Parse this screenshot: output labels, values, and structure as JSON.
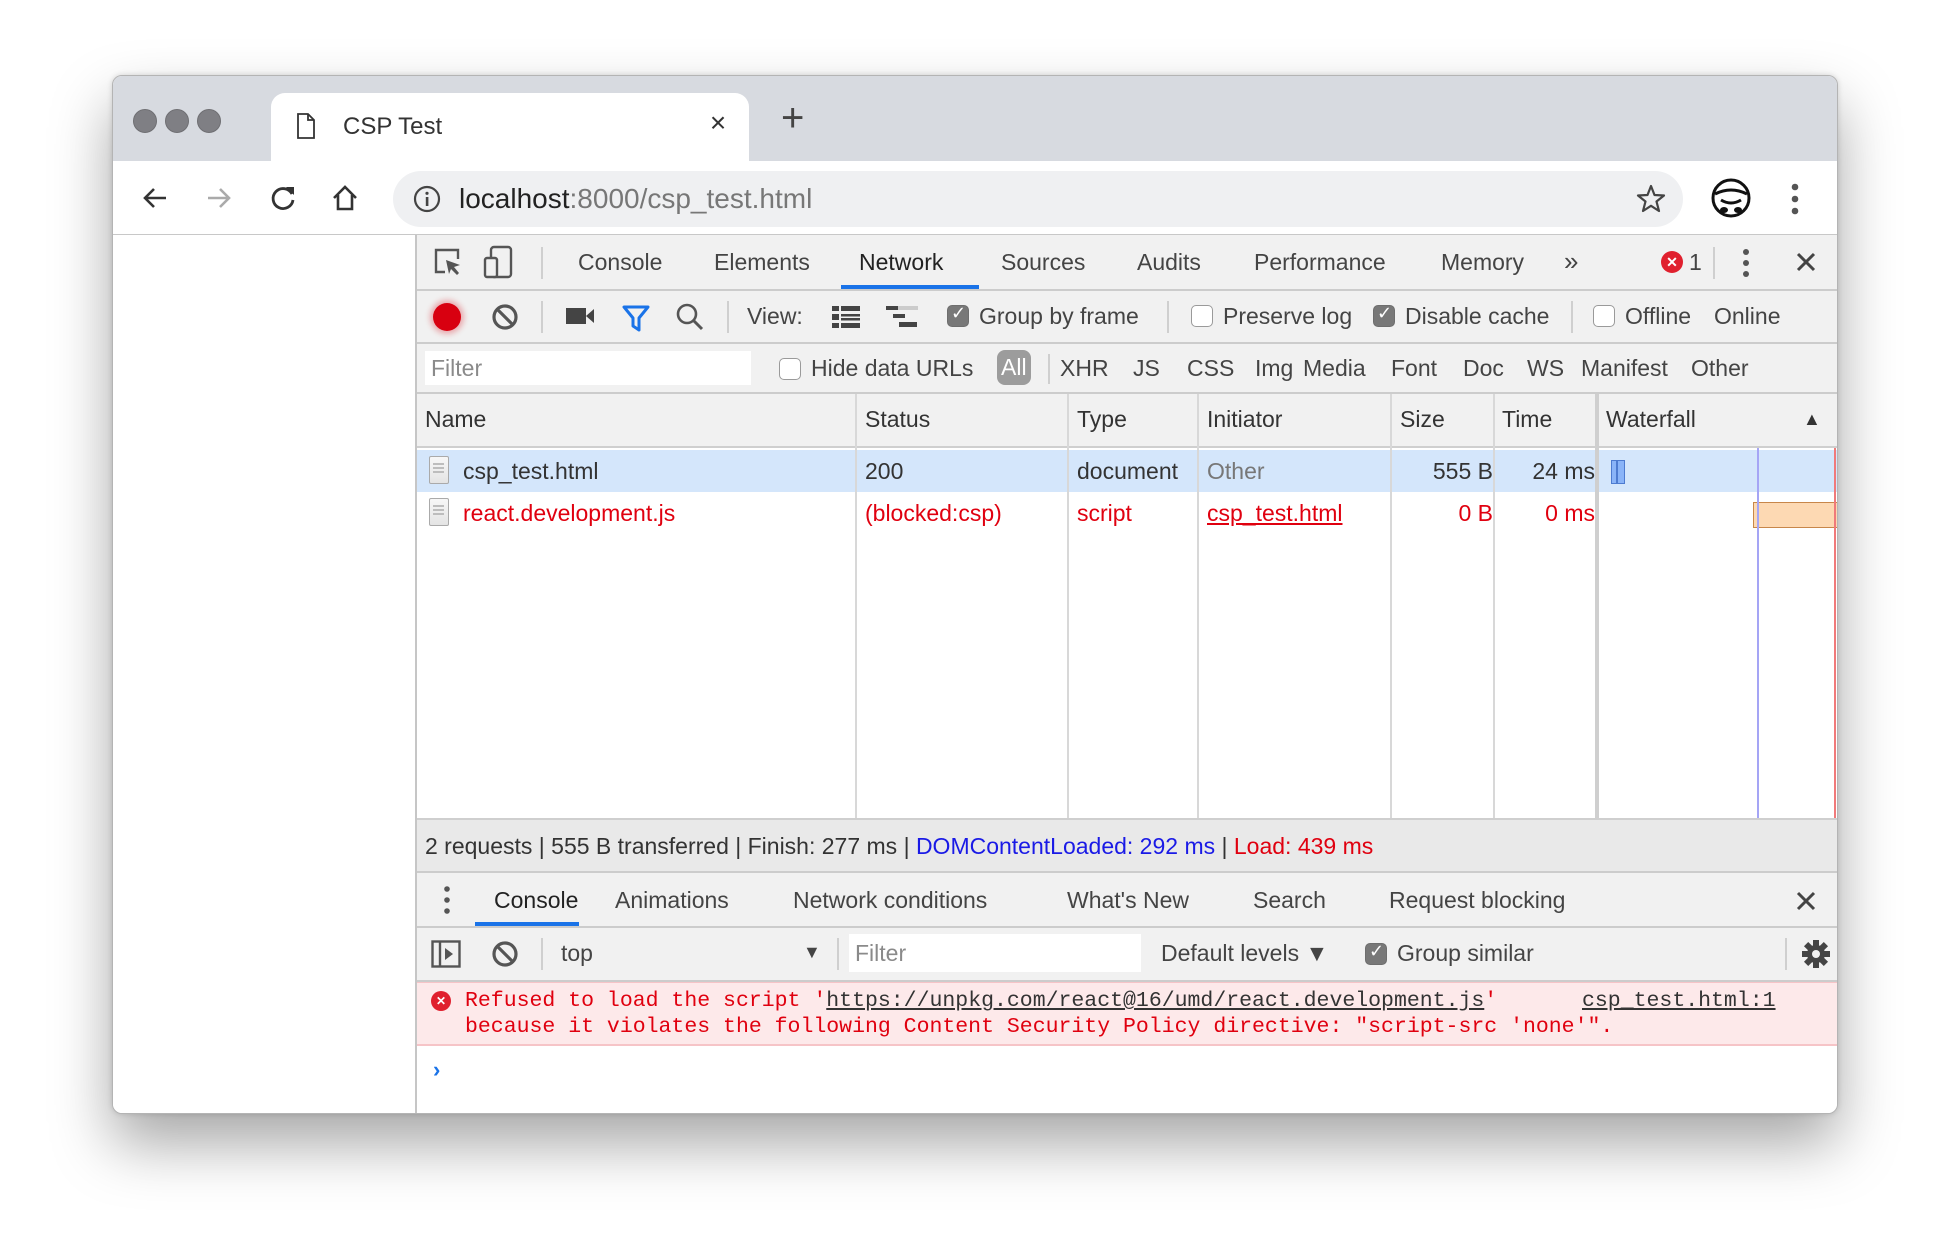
{
  "browser": {
    "tab": {
      "title": "CSP Test",
      "icon": "page-icon",
      "close_icon": "close-icon"
    },
    "new_tab_label": "+",
    "address": {
      "host": "localhost",
      "rest": ":8000/csp_test.html"
    },
    "icons": [
      "back-icon",
      "forward-icon",
      "reload-icon",
      "home-icon",
      "info-icon",
      "star-icon",
      "incognito-icon",
      "menu-icon"
    ]
  },
  "devtools": {
    "tabs": [
      "Console",
      "Elements",
      "Network",
      "Sources",
      "Audits",
      "Performance",
      "Memory"
    ],
    "active_tab": "Network",
    "more_tabs": "»",
    "error_count": "1",
    "network_toolbar": {
      "view_label": "View:",
      "group_by_frame": {
        "label": "Group by frame",
        "checked": true
      },
      "preserve_log": {
        "label": "Preserve log",
        "checked": false
      },
      "disable_cache": {
        "label": "Disable cache",
        "checked": true
      },
      "offline": {
        "label": "Offline",
        "checked": false
      },
      "throttling": "Online"
    },
    "filter_bar": {
      "placeholder": "Filter",
      "hide_data_urls": {
        "label": "Hide data URLs",
        "checked": false
      },
      "types": [
        "All",
        "XHR",
        "JS",
        "CSS",
        "Img",
        "Media",
        "Font",
        "Doc",
        "WS",
        "Manifest",
        "Other"
      ],
      "active_type": "All"
    },
    "table": {
      "columns": [
        "Name",
        "Status",
        "Type",
        "Initiator",
        "Size",
        "Time",
        "Waterfall"
      ],
      "sort_indicator": "▲",
      "rows": [
        {
          "name": "csp_test.html",
          "status": "200",
          "type": "document",
          "initiator": "Other",
          "size": "555 B",
          "time": "24 ms",
          "selected": true,
          "error": false
        },
        {
          "name": "react.development.js",
          "status": "(blocked:csp)",
          "type": "script",
          "initiator": "csp_test.html",
          "size": "0 B",
          "time": "0 ms",
          "selected": false,
          "error": true
        }
      ],
      "colors": {
        "selected_row": "#d4e6fb",
        "error_text": "#e0000f",
        "dom_line": "#a5a5f5",
        "load_line": "#f07a7a",
        "bar_doc": "#8ab4f8",
        "bar_script": "#fdd9b3"
      }
    },
    "summary": {
      "plain": "2 requests | 555 B transferred | Finish: 277 ms | ",
      "dcl": "DOMContentLoaded: 292 ms",
      "sep": " | ",
      "load": "Load: 439 ms"
    },
    "drawer": {
      "tabs": [
        "Console",
        "Animations",
        "Network conditions",
        "What's New",
        "Search",
        "Request blocking"
      ],
      "active_tab": "Console",
      "context": "top",
      "filter_placeholder": "Filter",
      "levels": "Default levels ▼",
      "group_similar": {
        "label": "Group similar",
        "checked": true
      },
      "message": {
        "line1_prefix": "Refused to load the script '",
        "url": "https://unpkg.com/react@16/umd/react.development.js",
        "line1_suffix": "'",
        "source": "csp_test.html:1",
        "line2": "because it violates the following Content Security Policy directive: \"script-src 'none'\"."
      },
      "prompt": "›"
    }
  }
}
